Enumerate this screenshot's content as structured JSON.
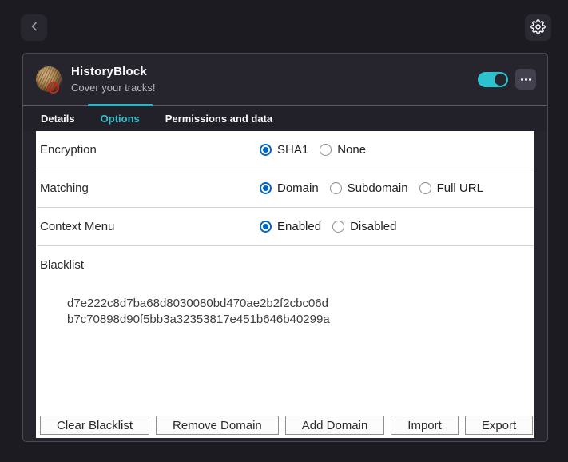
{
  "topbar": {
    "back_icon": "chevron-left",
    "settings_icon": "gear"
  },
  "extension": {
    "name": "HistoryBlock",
    "tagline": "Cover your tracks!",
    "enabled": true
  },
  "tabs": [
    {
      "label": "Details",
      "active": false
    },
    {
      "label": "Options",
      "active": true
    },
    {
      "label": "Permissions and data",
      "active": false
    }
  ],
  "options": {
    "rows": [
      {
        "label": "Encryption",
        "choices": [
          {
            "label": "SHA1",
            "selected": true
          },
          {
            "label": "None",
            "selected": false
          }
        ]
      },
      {
        "label": "Matching",
        "choices": [
          {
            "label": "Domain",
            "selected": true
          },
          {
            "label": "Subdomain",
            "selected": false
          },
          {
            "label": "Full URL",
            "selected": false
          }
        ]
      },
      {
        "label": "Context Menu",
        "choices": [
          {
            "label": "Enabled",
            "selected": true
          },
          {
            "label": "Disabled",
            "selected": false
          }
        ]
      }
    ],
    "blacklist": {
      "label": "Blacklist",
      "entries": [
        "d7e222c8d7ba68d8030080bd470ae2b2f2cbc06d",
        "b7c70898d90f5bb3a32353817e451b646b40299a"
      ]
    },
    "actions": [
      "Clear Blacklist",
      "Remove Domain",
      "Add Domain",
      "Import",
      "Export"
    ]
  },
  "colors": {
    "accent": "#35bdc9",
    "toggle_on": "#2cc3ce",
    "radio_selected": "#0067c0",
    "page_bg": "#1c1b22",
    "card_bg": "#26252e",
    "panel_bg": "#ffffff"
  }
}
